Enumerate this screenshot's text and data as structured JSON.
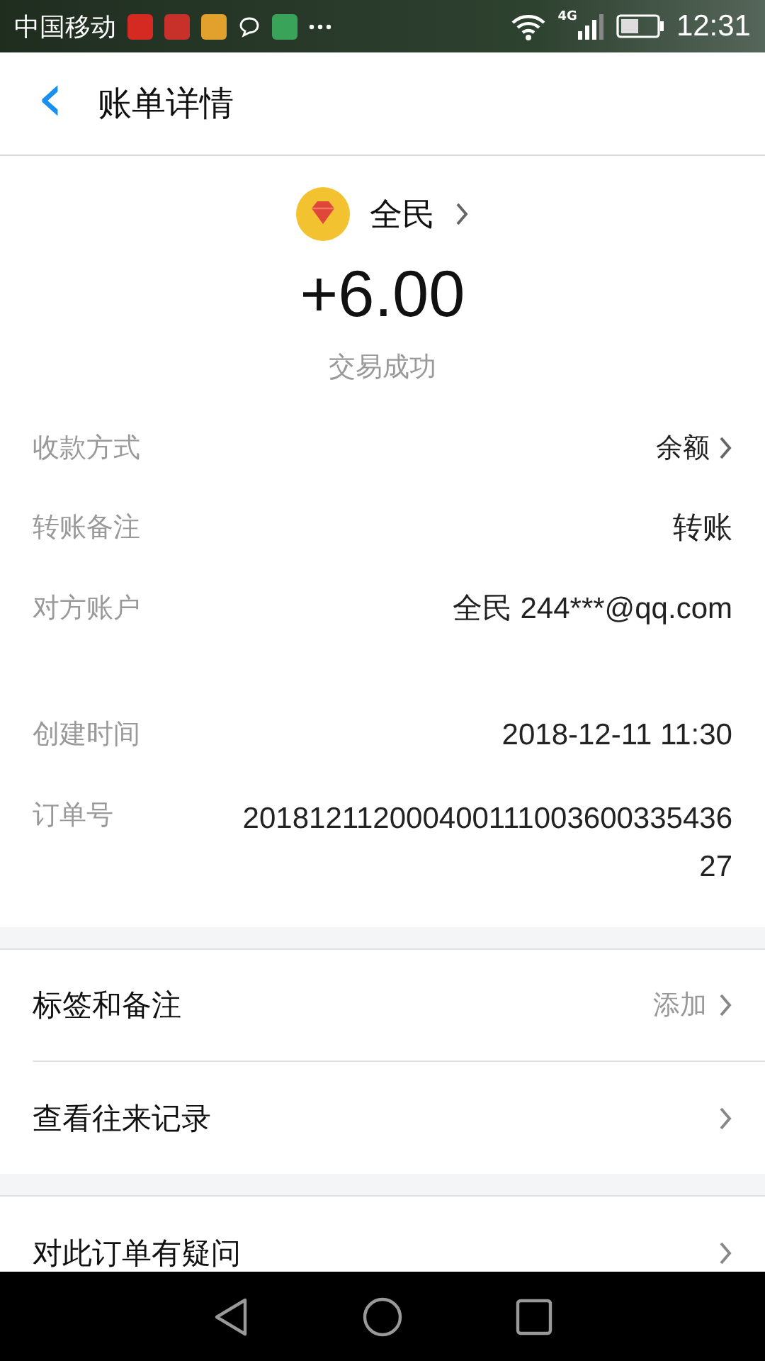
{
  "status_bar": {
    "carrier": "中国移动",
    "network": "4G",
    "time": "12:31",
    "notifications": [
      {
        "kind": "app",
        "color": "#d42a22"
      },
      {
        "kind": "app",
        "color": "#c8302a"
      },
      {
        "kind": "app",
        "color": "#e2a12c"
      },
      {
        "kind": "chat"
      },
      {
        "kind": "app",
        "color": "#3aa35a"
      },
      {
        "kind": "more"
      }
    ]
  },
  "header": {
    "back": "‹",
    "title": "账单详情"
  },
  "summary": {
    "merchant": "全民",
    "amount": "+6.00",
    "status": "交易成功"
  },
  "details": [
    {
      "label": "收款方式",
      "value": "余额",
      "kind": "link"
    },
    {
      "label": "转账备注",
      "value": "转账",
      "kind": "text"
    },
    {
      "label": "对方账户",
      "value": "全民 244***@qq.com",
      "kind": "text"
    },
    {
      "label": "创建时间",
      "value": "2018-12-11 11:30",
      "kind": "text"
    },
    {
      "label": "订单号",
      "value": "20181211200040011100360033543627",
      "kind": "number"
    }
  ],
  "sections": [
    [
      {
        "label": "标签和备注",
        "hint": "添加"
      },
      {
        "label": "查看往来记录"
      }
    ],
    [
      {
        "label": "对此订单有疑问"
      }
    ]
  ]
}
